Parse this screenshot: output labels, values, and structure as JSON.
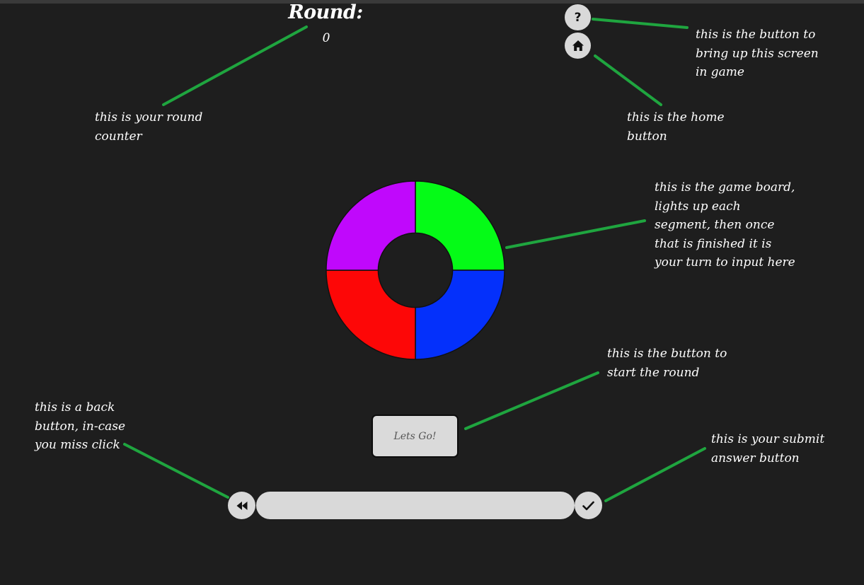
{
  "round": {
    "label": "Round:",
    "value": "0"
  },
  "buttons": {
    "help_label": "?",
    "home_icon": "home-icon",
    "start_label": "Lets Go!",
    "back_icon": "rewind-icon",
    "submit_icon": "checkmark-icon"
  },
  "board": {
    "segments": [
      {
        "name": "green",
        "color": "#05fb17"
      },
      {
        "name": "blue",
        "color": "#0430fb"
      },
      {
        "name": "red",
        "color": "#fd0707"
      },
      {
        "name": "purple",
        "color": "#c008fc"
      }
    ]
  },
  "annotations": {
    "round_counter": "this is your round counter",
    "help_button": "this is the button to bring up this screen in game",
    "home_button": "this is the home button",
    "game_board": "this is the game board, lights up each segment, then once that is finished it is your turn to input here",
    "start_button": "this is the button to start the round",
    "back_button": "this is a back button, in-case you miss click",
    "submit_button": "this is your submit answer button"
  },
  "colors": {
    "background": "#1e1e1e",
    "annotation_line": "#1fa53f",
    "button_fill": "#d9d9d9"
  }
}
